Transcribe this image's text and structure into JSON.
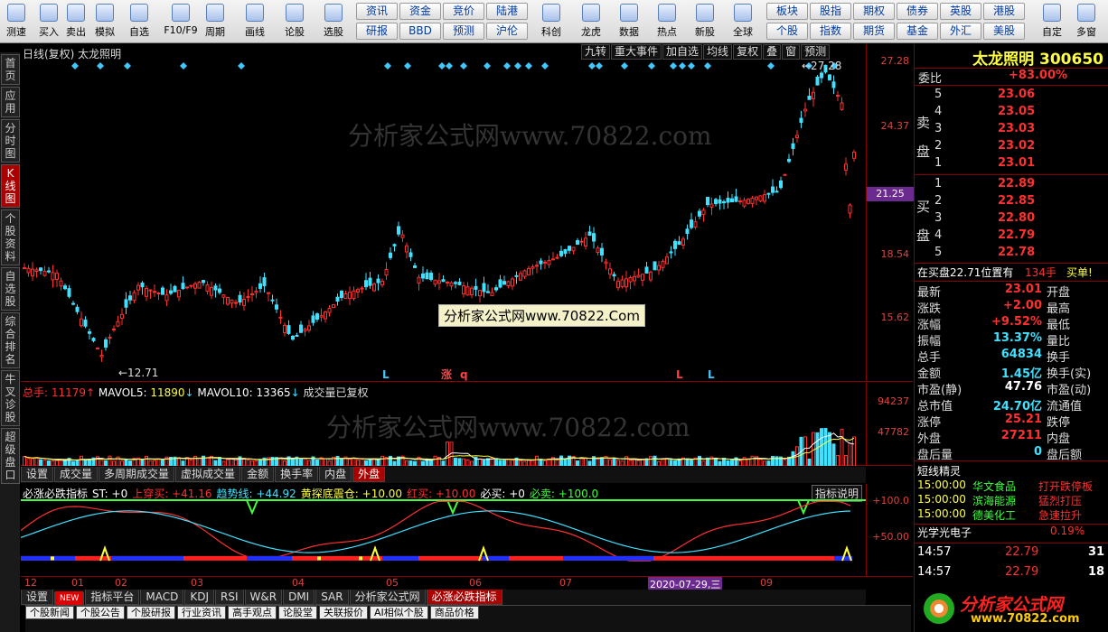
{
  "toolbar": {
    "left": [
      {
        "label": "测速",
        "icon": "stopwatch-icon"
      },
      {
        "label": "买入",
        "icon": "buy-icon"
      },
      {
        "label": "卖出",
        "icon": "sell-icon"
      },
      {
        "label": "模拟",
        "icon": "hammer-icon"
      },
      {
        "label": "自选",
        "icon": "star-icon"
      },
      {
        "label": "F10/F9",
        "icon": "f10-icon"
      },
      {
        "label": "周期",
        "icon": "clock-icon"
      },
      {
        "label": "画线",
        "icon": "pencil-icon"
      },
      {
        "label": "论股",
        "icon": "discuss-icon"
      },
      {
        "label": "选股",
        "icon": "pick-icon"
      }
    ],
    "grid": [
      [
        "资讯",
        "资金",
        "竞价",
        "陆港"
      ],
      [
        "研报",
        "BBD",
        "预测",
        "沪伦"
      ]
    ],
    "mid": [
      {
        "label": "科创",
        "icon": "kechuang-icon"
      },
      {
        "label": "龙虎",
        "icon": "dragon-icon"
      },
      {
        "label": "数据",
        "icon": "pe-icon"
      },
      {
        "label": "热点",
        "icon": "fire-icon"
      },
      {
        "label": "新股",
        "icon": "ipo-icon"
      },
      {
        "label": "全球",
        "icon": "globe-icon"
      }
    ],
    "grid2": [
      [
        "板块",
        "股指",
        "期权",
        "债券",
        "英股",
        "港股"
      ],
      [
        "个股",
        "指数",
        "期货",
        "基金",
        "外汇",
        "美股"
      ]
    ],
    "right": [
      {
        "label": "自定",
        "icon": "custom-icon"
      },
      {
        "label": "多窗",
        "icon": "multiwindow-icon"
      }
    ]
  },
  "sidebar": [
    "首页",
    "应用",
    "分时图",
    "K线图",
    "个股资料",
    "自选股",
    "综合排名",
    "牛叉诊股",
    "超级盘口"
  ],
  "kline": {
    "title": "日线(复权) 太龙照明",
    "buttons": [
      "九转",
      "重大事件",
      "加自选",
      "均线",
      "复权",
      "叠",
      "窗",
      "预测"
    ],
    "price_ticks": [
      "27.28",
      "24.37",
      "21.25",
      "18.54",
      "15.62"
    ],
    "low_label": "12.71",
    "high_label": "27.28",
    "current_price": "21.25",
    "watermark": "分析家公式网www.70822.com",
    "banner": "分析家公式网www.70822.Com",
    "markers": [
      "L",
      "涨",
      "q",
      "L",
      "L"
    ]
  },
  "volume": {
    "title_total_label": "总手: ",
    "total": "11179",
    "mavol5_label": "MAVOL5: ",
    "mavol5": "11890",
    "mavol10_label": "MAVOL10: ",
    "mavol10": "13365",
    "note": "成交量已复权",
    "ticks": [
      "94237",
      "47782"
    ],
    "tabs": [
      "设置",
      "成交量",
      "多周期成交量",
      "虚拟成交量",
      "金额",
      "换手率",
      "内盘",
      "外盘"
    ]
  },
  "indicator": {
    "name": "必涨必跌指标",
    "items": [
      {
        "label": "ST: ",
        "value": "+0",
        "color": "#ffffff"
      },
      {
        "label": "上穿买: ",
        "value": "+41.16",
        "color": "#ff3030"
      },
      {
        "label": "趋势线: ",
        "value": "+44.92",
        "color": "#40e0ff"
      },
      {
        "label": "黄探底震仓: ",
        "value": "+10.00",
        "color": "#ffff40"
      },
      {
        "label": "红买: ",
        "value": "+10.00",
        "color": "#ff3030"
      },
      {
        "label": "必买: ",
        "value": "+0",
        "color": "#ffffff"
      },
      {
        "label": "必卖: ",
        "value": "+100.0",
        "color": "#40ff40"
      }
    ],
    "help": "指标说明",
    "ticks": [
      "+100.0",
      "+50.00"
    ],
    "months": [
      "12",
      "01",
      "02",
      "03",
      "04",
      "05",
      "06",
      "07",
      "08",
      "09"
    ],
    "date_label": "2020-07-29,三",
    "tabs": [
      "设置",
      "NEW",
      "指标平台",
      "MACD",
      "KDJ",
      "RSI",
      "W&R",
      "DMI",
      "SAR",
      "分析家公式网",
      "必涨必跌指标"
    ]
  },
  "bottom_tabs": [
    "个股新闻",
    "个股公告",
    "个股研报",
    "行业资讯",
    "高手观点",
    "论股堂",
    "关联报价",
    "AI相似个股",
    "商品价格"
  ],
  "quote": {
    "name": "太龙照明",
    "code": "300650",
    "weibi_label": "委比",
    "weibi": "+83.00%",
    "sell_label": "卖盘",
    "buy_label": "买盘",
    "asks": [
      {
        "lvl": "5",
        "price": "23.06"
      },
      {
        "lvl": "4",
        "price": "23.05"
      },
      {
        "lvl": "3",
        "price": "23.03"
      },
      {
        "lvl": "2",
        "price": "23.02"
      },
      {
        "lvl": "1",
        "price": "23.01"
      }
    ],
    "bids": [
      {
        "lvl": "1",
        "price": "22.89"
      },
      {
        "lvl": "2",
        "price": "22.85"
      },
      {
        "lvl": "3",
        "price": "22.80"
      },
      {
        "lvl": "4",
        "price": "22.79"
      },
      {
        "lvl": "5",
        "price": "22.78"
      }
    ],
    "notice_a": "在买盘22.71位置有",
    "notice_b": "134手",
    "notice_c": "买单!",
    "stats": [
      {
        "l": "最新",
        "v": "23.01",
        "c": "#ff3030",
        "l2": "开盘"
      },
      {
        "l": "涨跌",
        "v": "+2.00",
        "c": "#ff3030",
        "l2": "最高"
      },
      {
        "l": "涨幅",
        "v": "+9.52%",
        "c": "#ff3030",
        "l2": "最低"
      },
      {
        "l": "振幅",
        "v": "13.37%",
        "c": "#40e0ff",
        "l2": "量比"
      },
      {
        "l": "总手",
        "v": "64834",
        "c": "#40e0ff",
        "l2": "换手"
      },
      {
        "l": "金额",
        "v": "1.45亿",
        "c": "#40e0ff",
        "l2": "换手(实)"
      },
      {
        "l": "市盈(静)",
        "v": "47.76",
        "c": "#ffffff",
        "l2": "市盈(动)"
      },
      {
        "l": "总市值",
        "v": "24.70亿",
        "c": "#40e0ff",
        "l2": "流通值"
      },
      {
        "l": "涨停",
        "v": "25.21",
        "c": "#ff3030",
        "l2": "跌停"
      },
      {
        "l": "外盘",
        "v": "27211",
        "c": "#ff3030",
        "l2": "内盘"
      },
      {
        "l": "盘后量",
        "v": "0",
        "c": "#40e0ff",
        "l2": "盘后额"
      }
    ],
    "elf_title": "短线精灵",
    "elf": [
      {
        "t": "15:00:00",
        "n": "华文食品",
        "s": "打开跌停板"
      },
      {
        "t": "15:00:00",
        "n": "滨海能源",
        "s": "猛烈打压"
      },
      {
        "t": "15:00:00",
        "n": "德美化工",
        "s": "急速拉升"
      }
    ],
    "sub_name": "光学光电子",
    "sub_pct": "0.19%",
    "ticks": [
      {
        "t": "14:57",
        "p": "22.79",
        "v": "31"
      },
      {
        "t": "14:57",
        "p": "22.79",
        "v": "18"
      }
    ],
    "brand": "分析家公式网",
    "brand_url": "www.70822.com"
  },
  "colors": {
    "up": "#ff3030",
    "down": "#40e0ff",
    "accent": "#a00000"
  }
}
